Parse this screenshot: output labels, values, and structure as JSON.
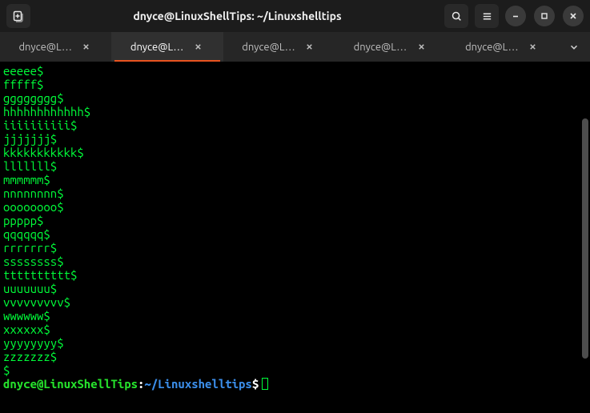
{
  "titlebar": {
    "title": "dnyce@LinuxShellTips: ~/Linuxshelltips"
  },
  "tabs": {
    "items": [
      {
        "label": "dnyce@L…",
        "active": false
      },
      {
        "label": "dnyce@L…",
        "active": true
      },
      {
        "label": "dnyce@L…",
        "active": false
      },
      {
        "label": "dnyce@L…",
        "active": false
      },
      {
        "label": "dnyce@L…",
        "active": false
      }
    ]
  },
  "terminal": {
    "lines": [
      "eeeee$",
      "fffff$",
      "gggggggg$",
      "hhhhhhhhhhhh$",
      "iiiiiiiiii$",
      "jjjjjjj$",
      "kkkkkkkkkkk$",
      "lllllll$",
      "mmmmmm$",
      "nnnnnnnn$",
      "oooooooo$",
      "ppppp$",
      "qqqqqq$",
      "rrrrrrr$",
      "ssssssss$",
      "tttttttttt$",
      "uuuuuuu$",
      "vvvvvvvvv$",
      "wwwwww$",
      "xxxxxx$",
      "yyyyyyyy$",
      "zzzzzzz$",
      "$"
    ],
    "prompt": {
      "user_host": "dnyce@LinuxShellTips",
      "colon": ":",
      "path": "~/Linuxshelltips",
      "end": "$"
    }
  }
}
